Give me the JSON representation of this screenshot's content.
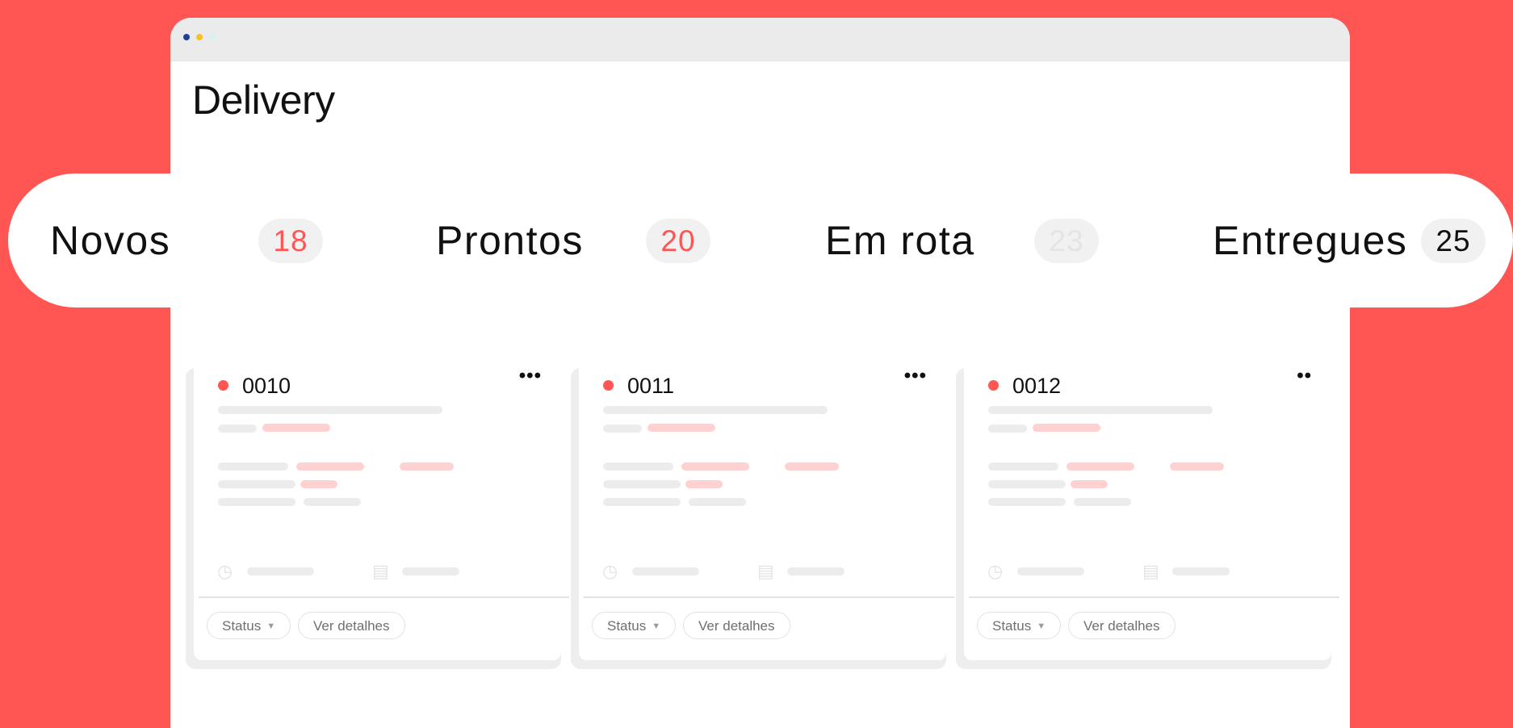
{
  "window": {
    "title": "Delivery"
  },
  "status_tabs": [
    {
      "label": "Novos",
      "count": "18",
      "count_color": "#ff5653"
    },
    {
      "label": "Prontos",
      "count": "20",
      "count_color": "#ff5653"
    },
    {
      "label": "Em rota",
      "count": "23",
      "count_color": "#e4e4e4"
    },
    {
      "label": "Entregues",
      "count": "25",
      "count_color": "#111111"
    }
  ],
  "cards": [
    {
      "number": "0010",
      "more": "•••",
      "status_label": "Status",
      "details_label": "Ver detalhes"
    },
    {
      "number": "0011",
      "more": "•••",
      "status_label": "Status",
      "details_label": "Ver detalhes"
    },
    {
      "number": "0012",
      "more": "••",
      "status_label": "Status",
      "details_label": "Ver detalhes"
    }
  ],
  "icons": {
    "clock": "clock-icon",
    "receipt": "receipt-icon",
    "dropdown": "caret-down-icon"
  },
  "colors": {
    "background": "#ff5653",
    "accent": "#ff5653",
    "skeleton_gray": "#ececec",
    "skeleton_pink": "#ffd1d0"
  }
}
